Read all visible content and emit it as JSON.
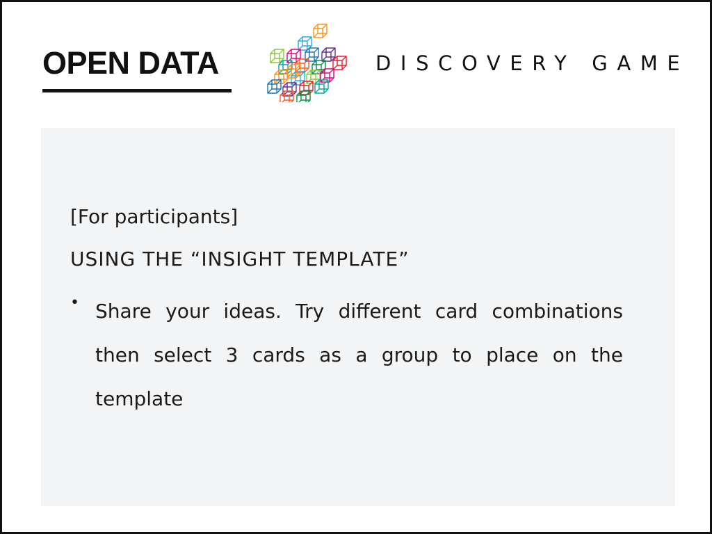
{
  "header": {
    "left_title": "OPEN DATA",
    "right_title": "DISCOVERY GAME",
    "logo_icon": "cube-cluster-icon"
  },
  "content": {
    "audience": "[For participants]",
    "heading": "USING THE “INSIGHT TEMPLATE”",
    "bullets": [
      "Share your ideas. Try different card combinations then select 3 cards as a group to place on the template"
    ]
  },
  "colors": {
    "text": "#111111",
    "panel_background": "#f3f4f5",
    "border": "#111111",
    "cube_palette": [
      "#f7931e",
      "#2aa8e0",
      "#8dc63f",
      "#e6007e",
      "#1b75bb",
      "#662d91",
      "#ed1c24",
      "#00a99d",
      "#f15a24",
      "#009245"
    ]
  }
}
